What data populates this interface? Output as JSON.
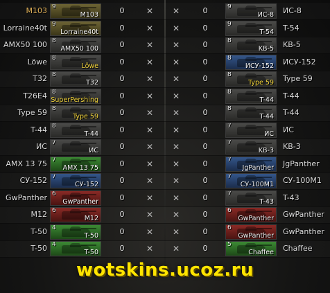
{
  "colors": {
    "self_name": "#e3b35a",
    "watermark": "#ffe400",
    "vehicle_label_special": "#f0d23a"
  },
  "status_icon": "destroyed-x-icon",
  "watermark": "wotskins.ucoz.ru",
  "left_team": [
    {
      "player": "M103",
      "vehicle": "M103",
      "tier": "9",
      "frags": "0",
      "status": "✕",
      "color": "gold",
      "self": true
    },
    {
      "player": "Lorraine40t",
      "vehicle": "Lorraine40t",
      "tier": "9",
      "frags": "0",
      "status": "✕",
      "color": "gold"
    },
    {
      "player": "AMX50 100",
      "vehicle": "AMX50 100",
      "tier": "8",
      "frags": "0",
      "status": "✕",
      "color": "neutral"
    },
    {
      "player": "Löwe",
      "vehicle": "Löwe",
      "tier": "8",
      "frags": "0",
      "status": "✕",
      "color": "neutral",
      "label_yellow": true
    },
    {
      "player": "T32",
      "vehicle": "T32",
      "tier": "8",
      "frags": "0",
      "status": "✕",
      "color": "neutral"
    },
    {
      "player": "T26E4",
      "vehicle": "SuperPershing",
      "tier": "8",
      "frags": "0",
      "status": "✕",
      "color": "neutral",
      "label_yellow": true
    },
    {
      "player": "Type 59",
      "vehicle": "Type 59",
      "tier": "8",
      "frags": "0",
      "status": "✕",
      "color": "neutral",
      "label_yellow": true
    },
    {
      "player": "T-44",
      "vehicle": "T-44",
      "tier": "8",
      "frags": "0",
      "status": "✕",
      "color": "neutral"
    },
    {
      "player": "ИС",
      "vehicle": "ИС",
      "tier": "7",
      "frags": "0",
      "status": "✕",
      "color": "neutral"
    },
    {
      "player": "AMX 13 75",
      "vehicle": "AMX 13 75",
      "tier": "7",
      "frags": "0",
      "status": "✕",
      "color": "green"
    },
    {
      "player": "СУ-152",
      "vehicle": "СУ-152",
      "tier": "7",
      "frags": "0",
      "status": "✕",
      "color": "blue"
    },
    {
      "player": "GwPanther",
      "vehicle": "GwPanther",
      "tier": "6",
      "frags": "0",
      "status": "✕",
      "color": "red"
    },
    {
      "player": "M12",
      "vehicle": "M12",
      "tier": "6",
      "frags": "0",
      "status": "✕",
      "color": "red"
    },
    {
      "player": "T-50",
      "vehicle": "T-50",
      "tier": "4",
      "frags": "0",
      "status": "✕",
      "color": "green"
    },
    {
      "player": "T-50",
      "vehicle": "T-50",
      "tier": "4",
      "frags": "0",
      "status": "✕",
      "color": "green"
    }
  ],
  "right_team": [
    {
      "player": "ИС-8",
      "vehicle": "ИС-8",
      "tier": "9",
      "frags": "0",
      "status": "✕",
      "color": "neutral"
    },
    {
      "player": "T-54",
      "vehicle": "T-54",
      "tier": "9",
      "frags": "0",
      "status": "✕",
      "color": "neutral"
    },
    {
      "player": "KB-5",
      "vehicle": "KB-5",
      "tier": "8",
      "frags": "0",
      "status": "✕",
      "color": "neutral"
    },
    {
      "player": "ИСУ-152",
      "vehicle": "ИСУ-152",
      "tier": "8",
      "frags": "0",
      "status": "✕",
      "color": "blue"
    },
    {
      "player": "Type 59",
      "vehicle": "Type 59",
      "tier": "8",
      "frags": "0",
      "status": "✕",
      "color": "neutral",
      "label_yellow": true
    },
    {
      "player": "T-44",
      "vehicle": "T-44",
      "tier": "8",
      "frags": "0",
      "status": "✕",
      "color": "neutral"
    },
    {
      "player": "T-44",
      "vehicle": "T-44",
      "tier": "8",
      "frags": "0",
      "status": "✕",
      "color": "neutral"
    },
    {
      "player": "ИС",
      "vehicle": "ИС",
      "tier": "7",
      "frags": "0",
      "status": "✕",
      "color": "neutral"
    },
    {
      "player": "KB-3",
      "vehicle": "KB-3",
      "tier": "7",
      "frags": "0",
      "status": "✕",
      "color": "neutral"
    },
    {
      "player": "JgPanther",
      "vehicle": "JgPanther",
      "tier": "7",
      "frags": "0",
      "status": "✕",
      "color": "blue"
    },
    {
      "player": "СУ-100M1",
      "vehicle": "СУ-100M1",
      "tier": "7",
      "frags": "0",
      "status": "✕",
      "color": "blue"
    },
    {
      "player": "T-43",
      "vehicle": "T-43",
      "tier": "7",
      "frags": "0",
      "status": "✕",
      "color": "neutral"
    },
    {
      "player": "GwPanther",
      "vehicle": "GwPanther",
      "tier": "6",
      "frags": "0",
      "status": "✕",
      "color": "red"
    },
    {
      "player": "GwPanther",
      "vehicle": "GwPanther",
      "tier": "6",
      "frags": "0",
      "status": "✕",
      "color": "red"
    },
    {
      "player": "Chaffee",
      "vehicle": "Chaffee",
      "tier": "5",
      "frags": "0",
      "status": "✕",
      "color": "green"
    }
  ]
}
